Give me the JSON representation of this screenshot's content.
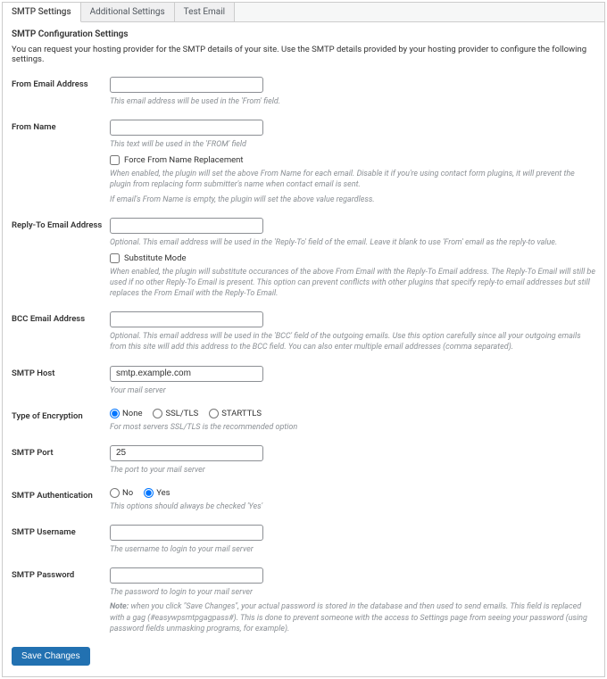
{
  "tabs": {
    "smtp": "SMTP Settings",
    "additional": "Additional Settings",
    "test": "Test Email"
  },
  "section_title": "SMTP Configuration Settings",
  "intro": "You can request your hosting provider for the SMTP details of your site. Use the SMTP details provided by your hosting provider to configure the following settings.",
  "from_email": {
    "label": "From Email Address",
    "value": "",
    "desc": "This email address will be used in the 'From' field."
  },
  "from_name": {
    "label": "From Name",
    "value": "",
    "desc1": "This text will be used in the 'FROM' field",
    "checkbox_label": "Force From Name Replacement",
    "desc2": "When enabled, the plugin will set the above From Name for each email. Disable it if you're using contact form plugins, it will prevent the plugin from replacing form submitter's name when contact email is sent.",
    "desc3": "If email's From Name is empty, the plugin will set the above value regardless."
  },
  "reply_to": {
    "label": "Reply-To Email Address",
    "value": "",
    "desc1": "Optional. This email address will be used in the 'Reply-To' field of the email. Leave it blank to use 'From' email as the reply-to value.",
    "checkbox_label": "Substitute Mode",
    "desc2": "When enabled, the plugin will substitute occurances of the above From Email with the Reply-To Email address. The Reply-To Email will still be used if no other Reply-To Email is present. This option can prevent conflicts with other plugins that specify reply-to email addresses but still replaces the From Email with the Reply-To Email."
  },
  "bcc": {
    "label": "BCC Email Address",
    "value": "",
    "desc": "Optional. This email address will be used in the 'BCC' field of the outgoing emails. Use this option carefully since all your outgoing emails from this site will add this address to the BCC field. You can also enter multiple email addresses (comma separated)."
  },
  "host": {
    "label": "SMTP Host",
    "value": "smtp.example.com",
    "desc": "Your mail server"
  },
  "encryption": {
    "label": "Type of Encryption",
    "options": {
      "none": "None",
      "ssl": "SSL/TLS",
      "starttls": "STARTTLS"
    },
    "desc": "For most servers SSL/TLS is the recommended option"
  },
  "port": {
    "label": "SMTP Port",
    "value": "25",
    "desc": "The port to your mail server"
  },
  "auth": {
    "label": "SMTP Authentication",
    "options": {
      "no": "No",
      "yes": "Yes"
    },
    "desc": "This options should always be checked 'Yes'"
  },
  "username": {
    "label": "SMTP Username",
    "value": "",
    "desc": "The username to login to your mail server"
  },
  "password": {
    "label": "SMTP Password",
    "value": "",
    "desc": "The password to login to your mail server",
    "note_label": "Note:",
    "note": " when you click \"Save Changes\", your actual password is stored in the database and then used to send emails. This field is replaced with a gag (#easywpsmtpgagpass#). This is done to prevent someone with the access to Settings page from seeing your password (using password fields unmasking programs, for example)."
  },
  "save_button": "Save Changes"
}
